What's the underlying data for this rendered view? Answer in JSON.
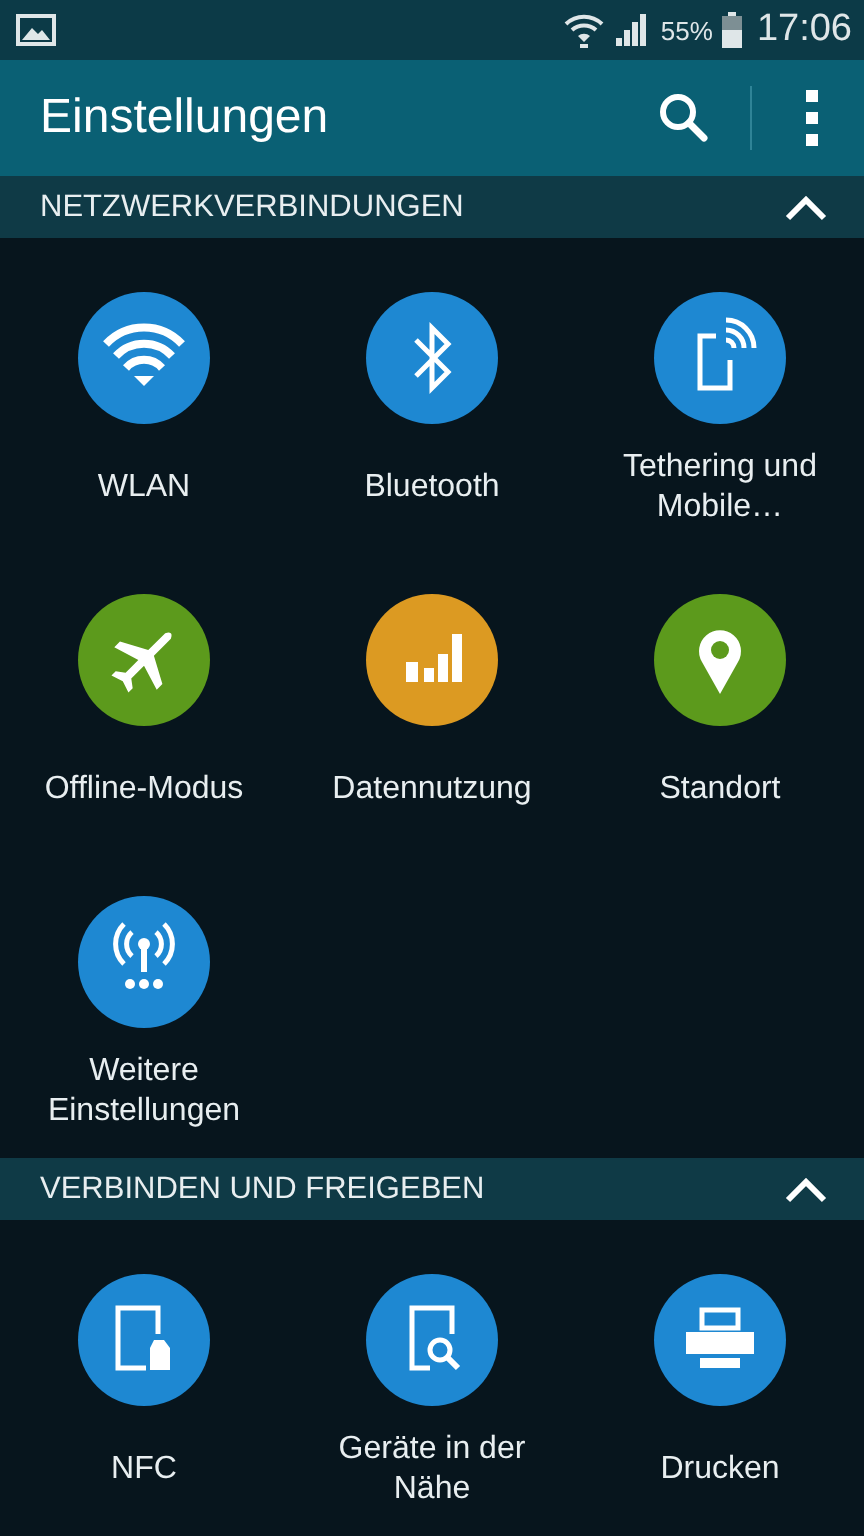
{
  "status_bar": {
    "battery": "55%",
    "time": "17:06"
  },
  "app_bar": {
    "title": "Einstellungen"
  },
  "sections": [
    {
      "title": "NETZWERKVERBINDUNGEN",
      "expanded": true,
      "items": [
        {
          "label": "WLAN",
          "color": "#1e88d2"
        },
        {
          "label": "Bluetooth",
          "color": "#1e88d2"
        },
        {
          "label": "Tethering und Mobile…",
          "color": "#1e88d2"
        },
        {
          "label": "Offline-Modus",
          "color": "#5c9a1c"
        },
        {
          "label": "Datennutzung",
          "color": "#dc9a22"
        },
        {
          "label": "Standort",
          "color": "#5c9a1c"
        },
        {
          "label": "Weitere Einstellungen",
          "color": "#1e88d2"
        }
      ]
    },
    {
      "title": "VERBINDEN UND FREIGEBEN",
      "expanded": true,
      "items": [
        {
          "label": "NFC",
          "color": "#1e88d2"
        },
        {
          "label": "Geräte in der Nähe",
          "color": "#1e88d2"
        },
        {
          "label": "Drucken",
          "color": "#1e88d2"
        }
      ]
    }
  ]
}
